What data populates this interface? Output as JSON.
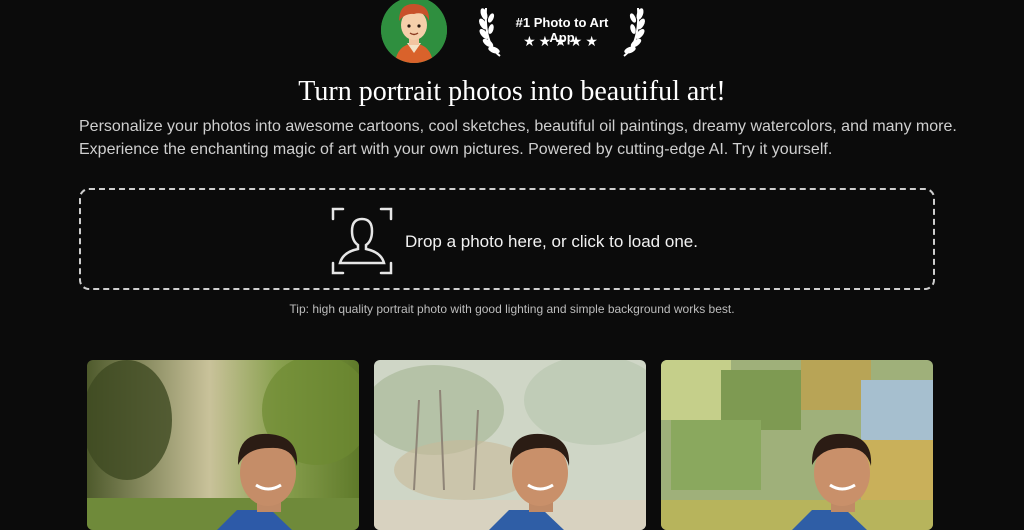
{
  "header": {
    "badge_title": "#1 Photo to Art App",
    "badge_stars": "★★★★★",
    "headline": "Turn portrait photos into beautiful art!"
  },
  "intro": {
    "line1": "Personalize your photos into awesome cartoons, cool sketches, beautiful oil paintings, dreamy watercolors, and many more.",
    "line2": "Experience the enchanting magic of art with your own pictures. Powered by cutting-edge AI. Try it yourself."
  },
  "upload": {
    "label": "Drop a photo here, or click to load one.",
    "icon": "person-frame-icon"
  },
  "tip": "Tip: high quality portrait photo with good lighting and simple background works best.",
  "examples": [
    {
      "style": "photo"
    },
    {
      "style": "watercolor"
    },
    {
      "style": "oil-painting"
    }
  ],
  "colors": {
    "background": "#0b0b0b",
    "avatar_bg": "#2f8f3f",
    "text": "#e9e9e9"
  }
}
